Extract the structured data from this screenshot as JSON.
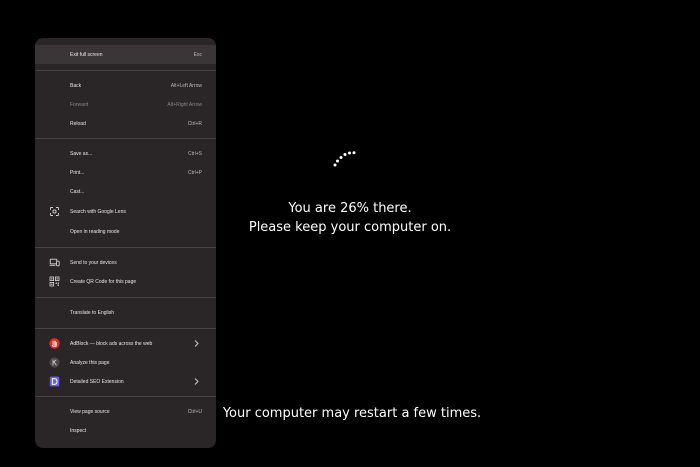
{
  "context_menu": {
    "items": [
      {
        "label": "Exit full screen",
        "shortcut": "Esc"
      },
      {
        "label": "Back",
        "shortcut": "Alt+Left Arrow"
      },
      {
        "label": "Forward",
        "shortcut": "Alt+Right Arrow",
        "disabled": true
      },
      {
        "label": "Reload",
        "shortcut": "Ctrl+R"
      },
      {
        "label": "Save as...",
        "shortcut": "Ctrl+S"
      },
      {
        "label": "Print...",
        "shortcut": "Ctrl+P"
      },
      {
        "label": "Cast..."
      },
      {
        "label": "Search with Google Lens",
        "icon": "google-lens-icon"
      },
      {
        "label": "Open in reading mode"
      },
      {
        "label": "Send to your devices",
        "icon": "devices-icon"
      },
      {
        "label": "Create QR Code for this page",
        "icon": "qr-code-icon"
      },
      {
        "label": "Translate to English"
      },
      {
        "label": "AdBlock — block ads across the web",
        "icon": "adblock-icon",
        "submenu": true
      },
      {
        "label": "Analyze this page",
        "icon": "analyze-extension-icon"
      },
      {
        "label": "Detailed SEO Extension",
        "icon": "detailed-seo-icon",
        "submenu": true
      },
      {
        "label": "View page source",
        "shortcut": "Ctrl+U"
      },
      {
        "label": "Inspect"
      }
    ]
  },
  "update_screen": {
    "progress_percent": 26,
    "line1": "You are 26% there.",
    "line2": "Please keep your computer on.",
    "footer": "Your computer may restart a few times."
  },
  "colors": {
    "menu_bg": "#2a2627",
    "adblock_red": "#e52b22",
    "seo_purple": "#6a5cf5"
  }
}
